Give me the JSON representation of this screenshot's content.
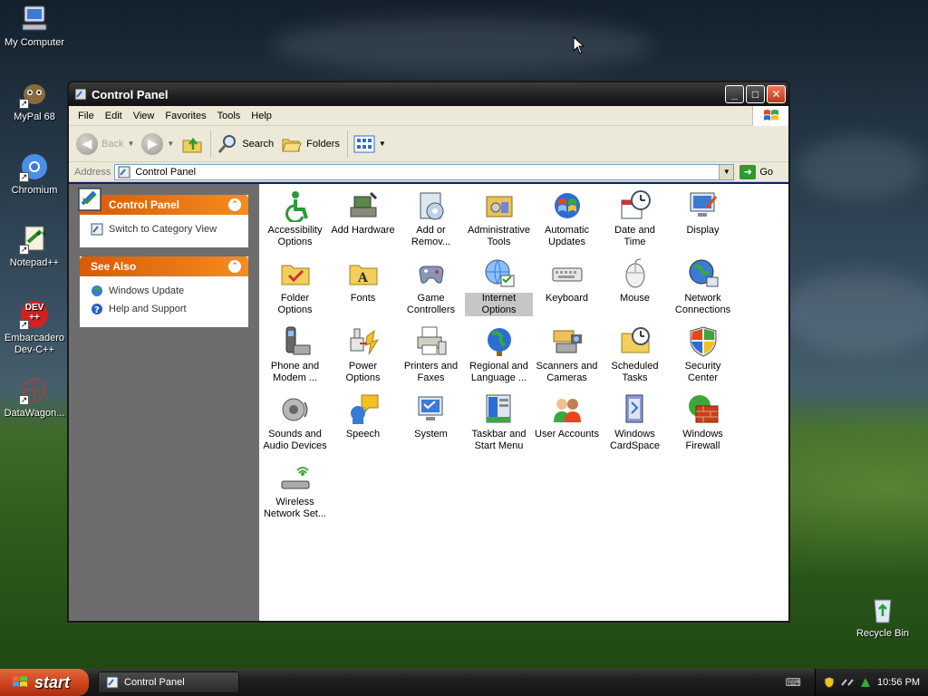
{
  "desktop": {
    "icons": [
      {
        "label": "My Computer"
      },
      {
        "label": "MyPal 68"
      },
      {
        "label": "Chromium"
      },
      {
        "label": "Notepad++"
      },
      {
        "label": "Embarcadero Dev-C++",
        "badge": "DEV ++"
      },
      {
        "label": "DataWagon..."
      },
      {
        "label": "Recycle Bin"
      }
    ]
  },
  "window": {
    "title": "Control Panel",
    "menu": [
      "File",
      "Edit",
      "View",
      "Favorites",
      "Tools",
      "Help"
    ],
    "toolbar": {
      "back": "Back",
      "search": "Search",
      "folders": "Folders"
    },
    "address": {
      "label": "Address",
      "value": "Control Panel",
      "go": "Go"
    },
    "taskpane": {
      "control_panel": {
        "title": "Control Panel",
        "links": [
          "Switch to Category View"
        ]
      },
      "see_also": {
        "title": "See Also",
        "links": [
          "Windows Update",
          "Help and Support"
        ]
      }
    },
    "items": [
      {
        "label": "Accessibility Options",
        "icon": "accessibility-icon"
      },
      {
        "label": "Add Hardware",
        "icon": "add-hardware-icon"
      },
      {
        "label": "Add or Remov...",
        "icon": "add-remove-programs-icon"
      },
      {
        "label": "Administrative Tools",
        "icon": "administrative-tools-icon"
      },
      {
        "label": "Automatic Updates",
        "icon": "automatic-updates-icon"
      },
      {
        "label": "Date and Time",
        "icon": "date-time-icon"
      },
      {
        "label": "Display",
        "icon": "display-icon"
      },
      {
        "label": "Folder Options",
        "icon": "folder-options-icon"
      },
      {
        "label": "Fonts",
        "icon": "fonts-icon"
      },
      {
        "label": "Game Controllers",
        "icon": "game-controllers-icon"
      },
      {
        "label": "Internet Options",
        "icon": "internet-options-icon",
        "selected": true
      },
      {
        "label": "Keyboard",
        "icon": "keyboard-icon"
      },
      {
        "label": "Mouse",
        "icon": "mouse-icon"
      },
      {
        "label": "Network Connections",
        "icon": "network-connections-icon"
      },
      {
        "label": "Phone and Modem ...",
        "icon": "phone-modem-icon"
      },
      {
        "label": "Power Options",
        "icon": "power-options-icon"
      },
      {
        "label": "Printers and Faxes",
        "icon": "printers-faxes-icon"
      },
      {
        "label": "Regional and Language ...",
        "icon": "regional-language-icon"
      },
      {
        "label": "Scanners and Cameras",
        "icon": "scanners-cameras-icon"
      },
      {
        "label": "Scheduled Tasks",
        "icon": "scheduled-tasks-icon"
      },
      {
        "label": "Security Center",
        "icon": "security-center-icon"
      },
      {
        "label": "Sounds and Audio Devices",
        "icon": "sounds-audio-icon"
      },
      {
        "label": "Speech",
        "icon": "speech-icon"
      },
      {
        "label": "System",
        "icon": "system-icon"
      },
      {
        "label": "Taskbar and Start Menu",
        "icon": "taskbar-start-menu-icon"
      },
      {
        "label": "User Accounts",
        "icon": "user-accounts-icon"
      },
      {
        "label": "Windows CardSpace",
        "icon": "cardspace-icon"
      },
      {
        "label": "Windows Firewall",
        "icon": "firewall-icon"
      },
      {
        "label": "Wireless Network Set...",
        "icon": "wireless-network-icon"
      }
    ]
  },
  "taskbar": {
    "start": "start",
    "task": "Control Panel",
    "clock": "10:56 PM"
  },
  "colors": {
    "taskpane_header": "#e8731a",
    "titlebar": "#2a2a2a",
    "start_button": "#c8401a"
  }
}
